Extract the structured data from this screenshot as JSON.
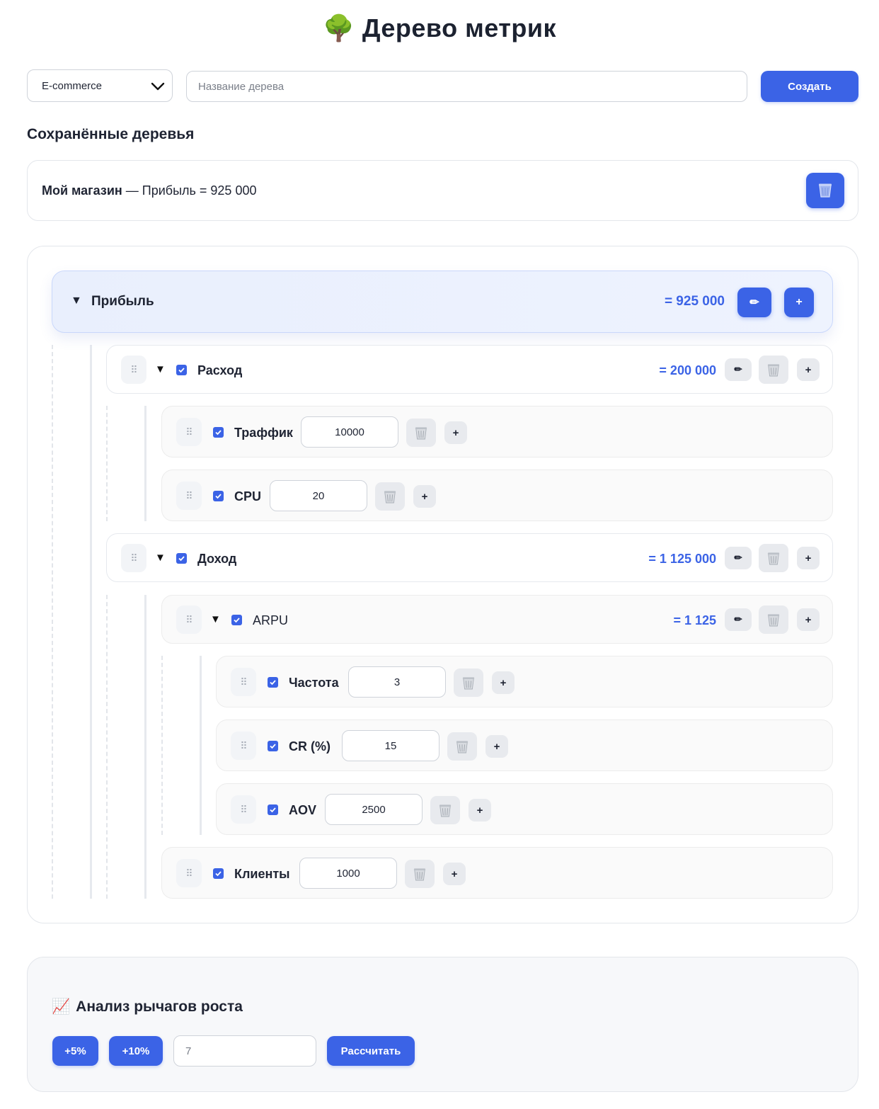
{
  "header": {
    "emoji": "🌳",
    "title": "Дерево метрик"
  },
  "controls": {
    "template_selected": "E-commerce",
    "tree_name_placeholder": "Название дерева",
    "create_label": "Создать"
  },
  "saved": {
    "heading": "Сохранённые деревья",
    "items": [
      {
        "name": "Мой магазин",
        "summary": " — Прибыль = 925 000"
      }
    ]
  },
  "tree": {
    "root": {
      "label": "Прибыль",
      "value": "= 925 000",
      "edit_icon": "✏",
      "add_icon": "+"
    },
    "expense": {
      "label": "Расход",
      "value": "= 200 000",
      "traffic": {
        "label": "Траффик",
        "input": "10000"
      },
      "cpu": {
        "label": "CPU",
        "input": "20"
      }
    },
    "income": {
      "label": "Доход",
      "value": "= 1 125 000",
      "arpu": {
        "label": "ARPU",
        "value": "= 1 125",
        "frequency": {
          "label": "Частота",
          "input": "3"
        },
        "cr": {
          "label": "CR (%)",
          "input": "15"
        },
        "aov": {
          "label": "AOV",
          "input": "2500"
        }
      },
      "clients": {
        "label": "Клиенты",
        "input": "1000"
      }
    },
    "icons": {
      "caret": "▼",
      "drag": "⠿",
      "edit": "✏",
      "plus": "+"
    }
  },
  "growth": {
    "emoji": "📈",
    "title": "Анализ рычагов роста",
    "btn_5": "+5%",
    "btn_10": "+10%",
    "input_placeholder": "7",
    "calc_label": "Рассчитать"
  },
  "colors": {
    "accent": "#3b63e6",
    "root_bg": "#e9effd",
    "muted_btn": "#e8eaee"
  }
}
